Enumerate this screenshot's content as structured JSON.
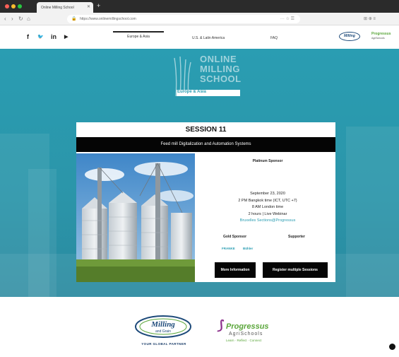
{
  "browser": {
    "tab_title": "Online Milling School",
    "address": "https://www.onlinemillingschool.com",
    "nav_glyphs": {
      "back": "‹",
      "forward": "›",
      "reload": "↻",
      "home": "⌂"
    },
    "url_tools": "··· ☆ ☰",
    "right_tools": "⊞ ⊕ ≡"
  },
  "header": {
    "social": [
      {
        "name": "facebook",
        "glyph": "f"
      },
      {
        "name": "twitter",
        "glyph": "🐦"
      },
      {
        "name": "linkedin",
        "glyph": "in"
      },
      {
        "name": "youtube",
        "glyph": "▶"
      }
    ],
    "nav": [
      {
        "label": "Europe & Asia",
        "active": true
      },
      {
        "label": "U.S. & Latin America",
        "active": false
      },
      {
        "label": "FAQ",
        "active": false
      }
    ],
    "logo_left": "Milling",
    "logo_right": {
      "name": "Progressus",
      "sub": "AgriSchools"
    }
  },
  "hero": {
    "school_lines": [
      "ONLINE",
      "MILLING",
      "SCHOOL"
    ],
    "school_sub": "Europe & Asia",
    "accent": "#2a9db2"
  },
  "session": {
    "title": "SESSION 11",
    "subtitle": "Feed mill Digitalization and Automation Systems",
    "platinum_label": "Platinum Sponsor",
    "date": "September 23, 2020",
    "time_bangkok": "2 PM Bangkok time (ICT, UTC +7)",
    "time_london": "8 AM London time",
    "format": "2 hours | Live Webinar",
    "contact": "Bruxelles Sections@Progressus",
    "gold_label": "Gold Sponsor",
    "supporter_label": "Supporter",
    "gold_logos": [
      "FRANKE",
      "Bühler"
    ],
    "btn_more": "More Information",
    "btn_register": "Register multiple Sessions"
  },
  "footer": {
    "milling_logo": "Milling",
    "milling_logo_sub": "and Grain",
    "milling_tagline": "YOUR GLOBAL PARTNER",
    "progressus_name": "Progressus",
    "progressus_sub": "AgriSchools",
    "progressus_tagline": "Learn · Reflect · Connect"
  }
}
